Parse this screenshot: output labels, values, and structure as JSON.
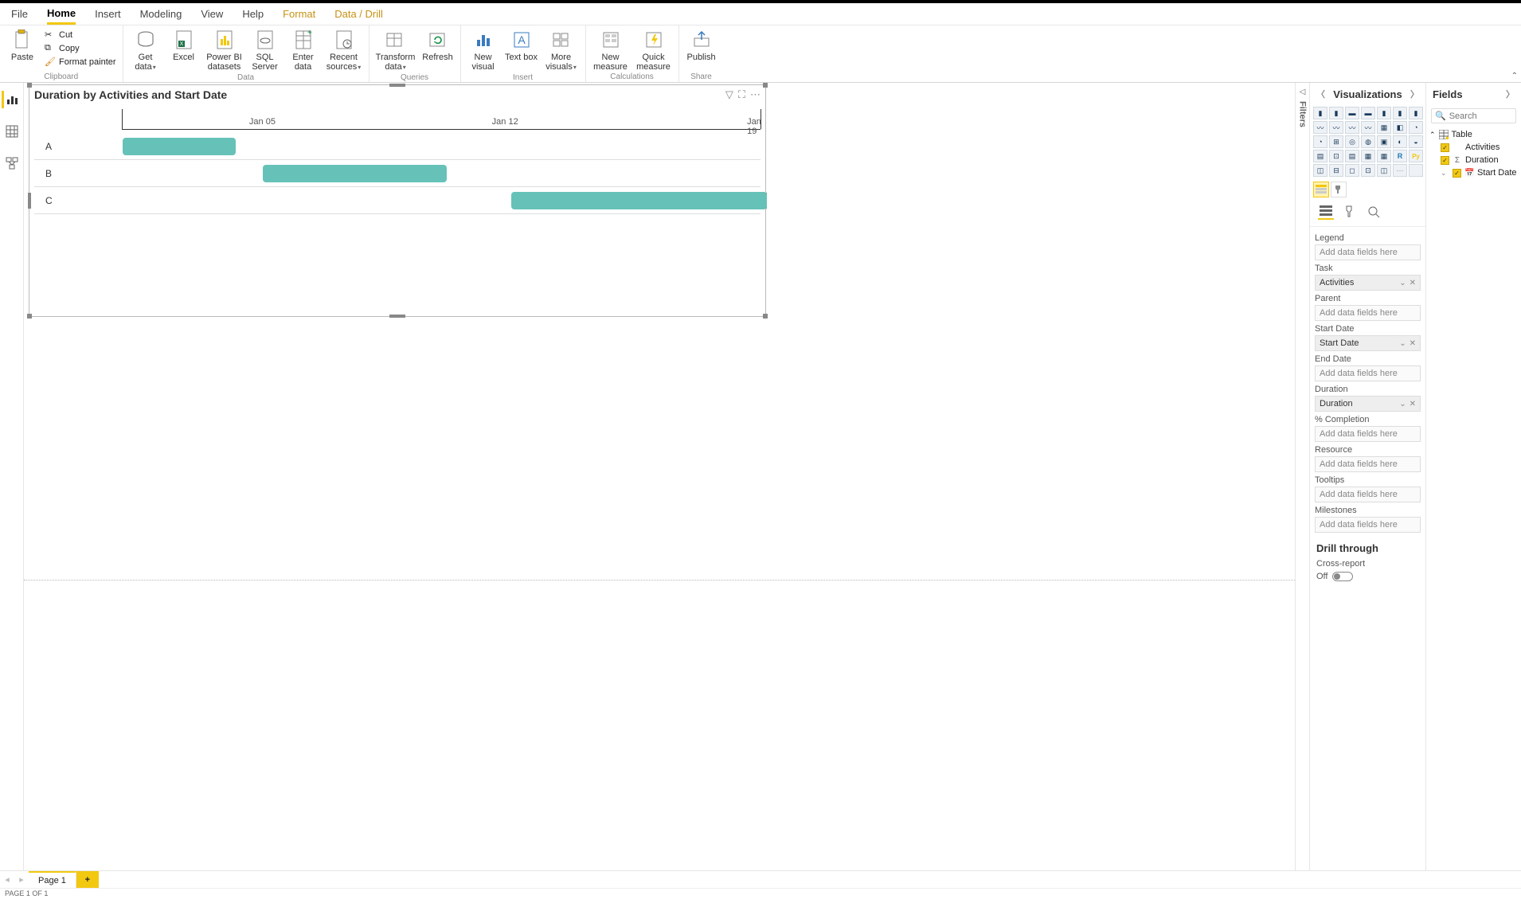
{
  "menu": {
    "tabs": [
      "File",
      "Home",
      "Insert",
      "Modeling",
      "View",
      "Help",
      "Format",
      "Data / Drill"
    ],
    "active": "Home"
  },
  "ribbon": {
    "paste": "Paste",
    "cut": "Cut",
    "copy": "Copy",
    "format_painter": "Format painter",
    "clipboard_group": "Clipboard",
    "get_data": "Get data",
    "excel": "Excel",
    "pbi_datasets": "Power BI datasets",
    "sql_server": "SQL Server",
    "enter_data": "Enter data",
    "recent_sources": "Recent sources",
    "data_group": "Data",
    "transform": "Transform data",
    "refresh": "Refresh",
    "queries_group": "Queries",
    "new_visual": "New visual",
    "text_box": "Text box",
    "more_visuals": "More visuals",
    "insert_group": "Insert",
    "new_measure": "New measure",
    "quick_measure": "Quick measure",
    "calculations_group": "Calculations",
    "publish": "Publish",
    "share_group": "Share"
  },
  "filters_label": "Filters",
  "viz_pane": {
    "title": "Visualizations",
    "wells": {
      "legend": "Legend",
      "task": "Task",
      "parent": "Parent",
      "start_date": "Start Date",
      "end_date": "End Date",
      "duration": "Duration",
      "completion": "% Completion",
      "resource": "Resource",
      "tooltips": "Tooltips",
      "milestones": "Milestones"
    },
    "placeholder": "Add data fields here",
    "task_value": "Activities",
    "start_value": "Start Date",
    "duration_value": "Duration",
    "drill_through": "Drill through",
    "cross_report": "Cross-report",
    "cross_report_state": "Off"
  },
  "fields_pane": {
    "title": "Fields",
    "search_placeholder": "Search",
    "table_name": "Table",
    "fields": {
      "activities": "Activities",
      "duration": "Duration",
      "start_date": "Start Date"
    }
  },
  "page_tabs": {
    "page1": "Page 1"
  },
  "status": "PAGE 1 OF 1",
  "chart_data": {
    "type": "bar",
    "title": "Duration by Activities and Start Date",
    "xlabel": "",
    "ylabel": "",
    "categories": [
      "A",
      "B",
      "C"
    ],
    "axis_ticks": [
      "Jan 05",
      "Jan 12",
      "Jan 19"
    ],
    "bars": [
      {
        "activity": "A",
        "start_pct": 1.4,
        "width_pct": 17.5
      },
      {
        "activity": "B",
        "start_pct": 23.0,
        "width_pct": 28.5
      },
      {
        "activity": "C",
        "start_pct": 61.5,
        "width_pct": 39.5
      }
    ],
    "bar_color": "#66c2b8"
  }
}
